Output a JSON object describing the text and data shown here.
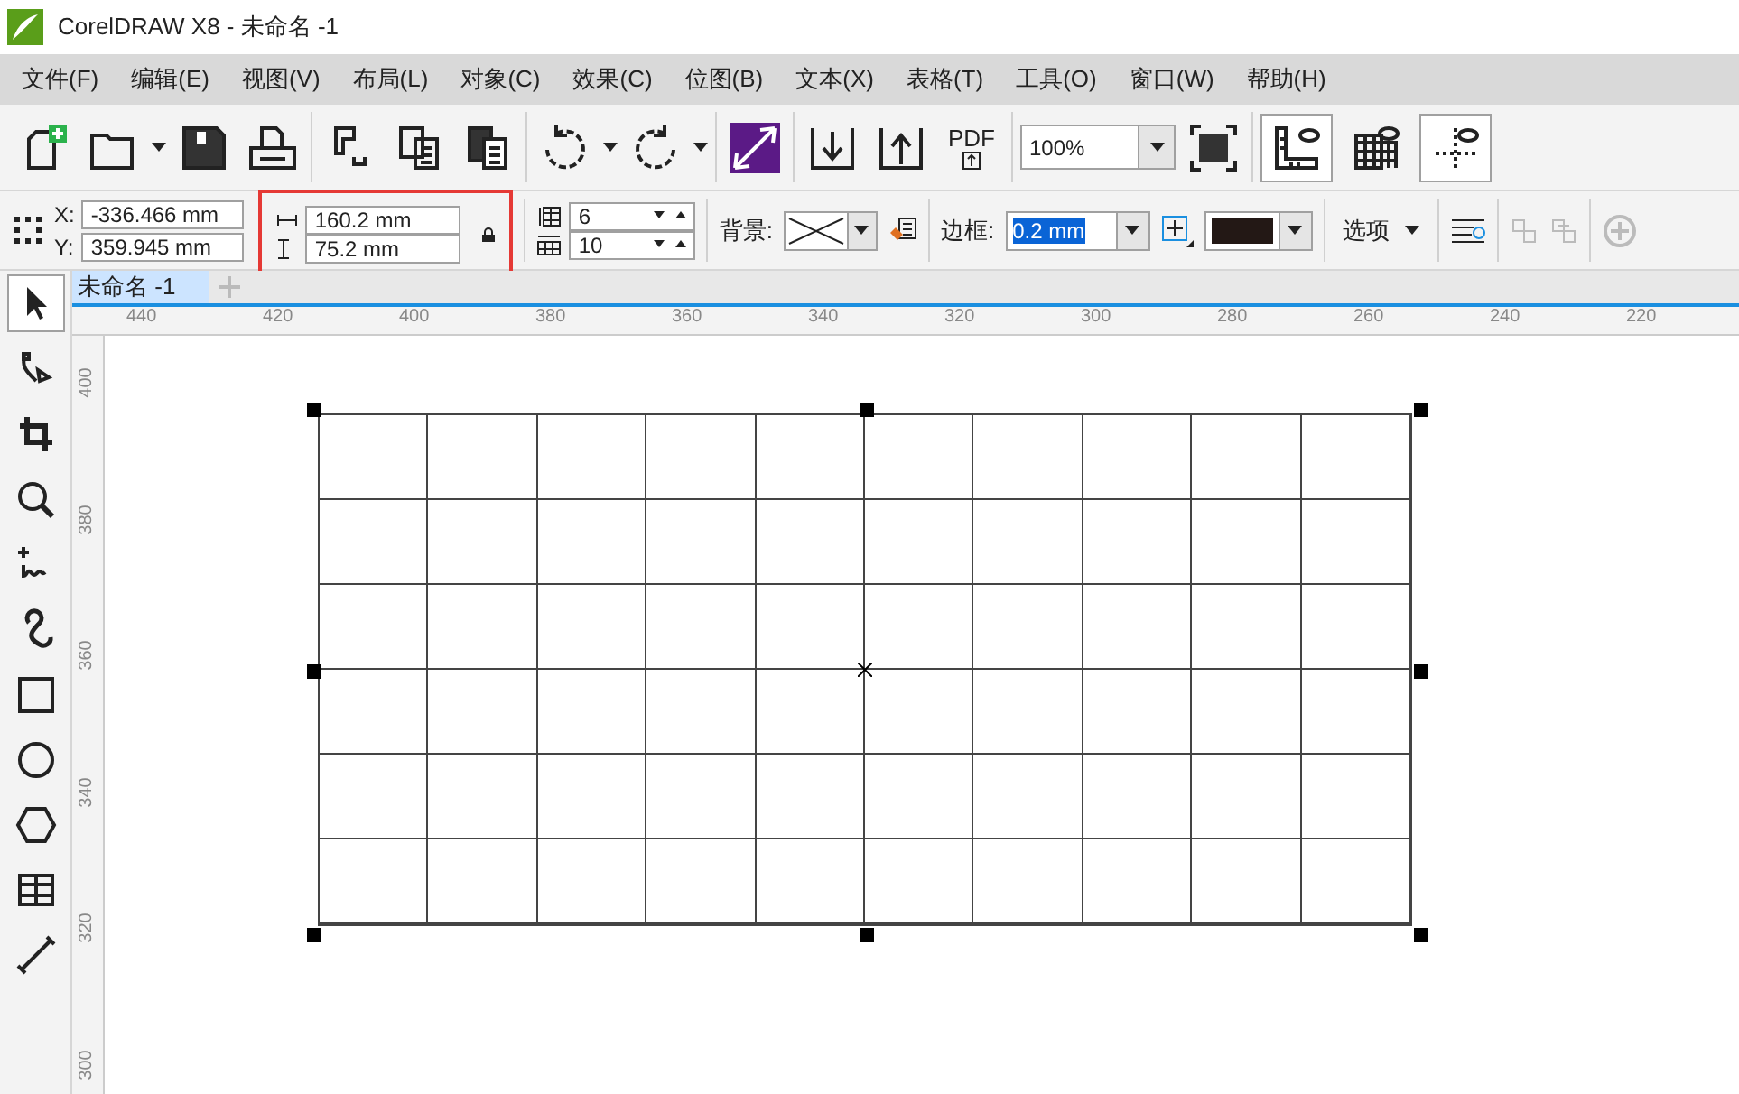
{
  "window": {
    "title": "CorelDRAW X8 - 未命名 -1"
  },
  "menu": [
    "文件(F)",
    "编辑(E)",
    "视图(V)",
    "布局(L)",
    "对象(C)",
    "效果(C)",
    "位图(B)",
    "文本(X)",
    "表格(T)",
    "工具(O)",
    "窗口(W)",
    "帮助(H)"
  ],
  "toolbar": {
    "pdf_label": "PDF",
    "zoom": "100%"
  },
  "property_bar": {
    "x_label": "X:",
    "x": "-336.466 mm",
    "y_label": "Y:",
    "y": "359.945 mm",
    "width": "160.2 mm",
    "height": "75.2 mm",
    "rows": "6",
    "columns": "10",
    "background_label": "背景:",
    "border_label": "边框:",
    "border_width": "0.2 mm",
    "options": "选项"
  },
  "document_tabs": [
    {
      "label": "未命名 -1",
      "selected": true
    }
  ],
  "ruler": {
    "horizontal": [
      "440",
      "420",
      "400",
      "380",
      "360",
      "340",
      "320",
      "300",
      "280",
      "260",
      "240",
      "220"
    ],
    "vertical": [
      "400",
      "380",
      "360",
      "340",
      "320",
      "300"
    ]
  }
}
